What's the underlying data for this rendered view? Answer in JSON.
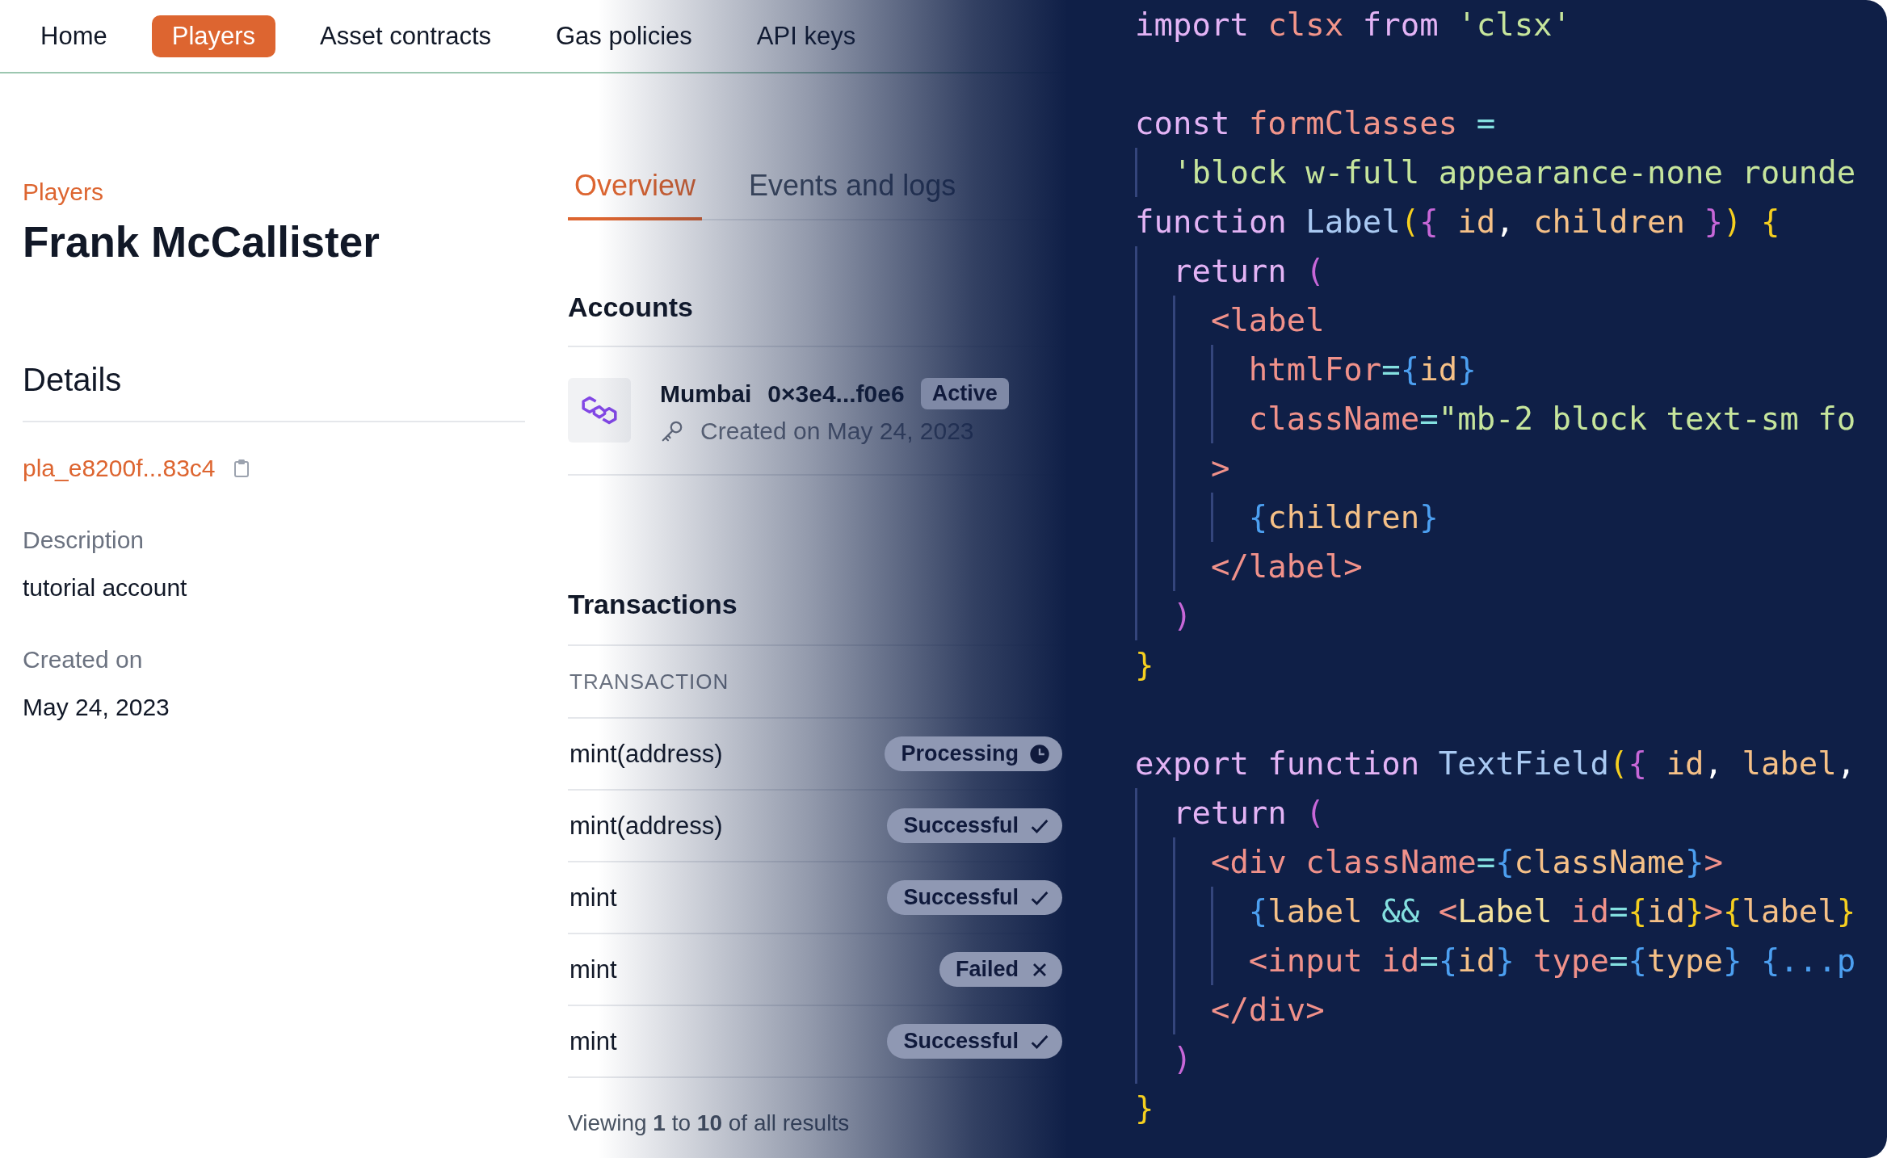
{
  "nav": {
    "items": [
      {
        "label": "Home",
        "selected": false
      },
      {
        "label": "Players",
        "selected": true
      },
      {
        "label": "Asset contracts",
        "selected": false
      },
      {
        "label": "Gas policies",
        "selected": false
      },
      {
        "label": "API keys",
        "selected": false
      }
    ]
  },
  "player": {
    "breadcrumb": "Players",
    "name": "Frank McCallister",
    "details_heading": "Details",
    "id": "pla_e8200f...83c4",
    "fields": [
      {
        "label": "Description",
        "value": "tutorial account"
      },
      {
        "label": "Created on",
        "value": "May 24, 2023"
      }
    ]
  },
  "tabs": [
    {
      "label": "Overview",
      "selected": true
    },
    {
      "label": "Events and logs",
      "selected": false
    }
  ],
  "accounts": {
    "heading": "Accounts",
    "items": [
      {
        "network": "Mumbai",
        "address": "0×3e4...f0e6",
        "status": "Active",
        "created": "Created on May 24, 2023"
      }
    ]
  },
  "transactions": {
    "heading": "Transactions",
    "column": "TRANSACTION",
    "rows": [
      {
        "name": "mint(address)",
        "status": "Processing",
        "kind": "processing"
      },
      {
        "name": "mint(address)",
        "status": "Successful",
        "kind": "success"
      },
      {
        "name": "mint",
        "status": "Successful",
        "kind": "success"
      },
      {
        "name": "mint",
        "status": "Failed",
        "kind": "failed"
      },
      {
        "name": "mint",
        "status": "Successful",
        "kind": "success"
      }
    ],
    "footer": "Viewing **1** to **10** of all results"
  },
  "code": {
    "lines": [
      {
        "kind": "code",
        "tokens": [
          {
            "t": "import ",
            "kind": "kw"
          },
          {
            "t": "clsx ",
            "kind": "var"
          },
          {
            "t": "from ",
            "kind": "kw"
          },
          {
            "t": "'clsx'",
            "kind": "str"
          }
        ]
      },
      {
        "kind": "blank"
      },
      {
        "kind": "code",
        "tokens": [
          {
            "t": "const ",
            "kind": "kw"
          },
          {
            "t": "formClasses ",
            "kind": "var"
          },
          {
            "t": "=",
            "kind": "op"
          }
        ]
      },
      {
        "kind": "code",
        "tokens": [
          {
            "t": "  'block w-full appearance-none rounde",
            "kind": "str"
          }
        ]
      },
      {
        "kind": "code",
        "tokens": [
          {
            "t": "function ",
            "kind": "kw"
          },
          {
            "t": "Label",
            "kind": "fn"
          },
          {
            "t": "(",
            "kind": "b1"
          },
          {
            "t": "{",
            "kind": "b2"
          },
          {
            "t": " id",
            "kind": "param"
          },
          {
            "t": ", ",
            "kind": "plain"
          },
          {
            "t": "children",
            "kind": "param"
          },
          {
            "t": " }",
            "kind": "b2"
          },
          {
            "t": ")",
            "kind": "b1"
          },
          {
            "t": " {",
            "kind": "b1"
          }
        ]
      },
      {
        "kind": "code",
        "tokens": [
          {
            "t": "  return ",
            "kind": "kw"
          },
          {
            "t": "(",
            "kind": "b2"
          }
        ]
      },
      {
        "kind": "code",
        "tokens": [
          {
            "t": "    <label",
            "kind": "tag"
          }
        ]
      },
      {
        "kind": "code",
        "tokens": [
          {
            "t": "      htmlFor",
            "kind": "tag"
          },
          {
            "t": "=",
            "kind": "op"
          },
          {
            "t": "{",
            "kind": "jsx"
          },
          {
            "t": "id",
            "kind": "param"
          },
          {
            "t": "}",
            "kind": "jsx"
          }
        ]
      },
      {
        "kind": "code",
        "tokens": [
          {
            "t": "      className",
            "kind": "tag"
          },
          {
            "t": "=",
            "kind": "op"
          },
          {
            "t": "\"mb-2 block text-sm fo",
            "kind": "str"
          }
        ]
      },
      {
        "kind": "code",
        "tokens": [
          {
            "t": "    >",
            "kind": "tag"
          }
        ]
      },
      {
        "kind": "code",
        "tokens": [
          {
            "t": "      {",
            "kind": "jsx"
          },
          {
            "t": "children",
            "kind": "param"
          },
          {
            "t": "}",
            "kind": "jsx"
          }
        ]
      },
      {
        "kind": "code",
        "tokens": [
          {
            "t": "    </label>",
            "kind": "tag"
          }
        ]
      },
      {
        "kind": "code",
        "tokens": [
          {
            "t": "  )",
            "kind": "b2"
          }
        ]
      },
      {
        "kind": "code",
        "tokens": [
          {
            "t": "}",
            "kind": "b1"
          }
        ]
      },
      {
        "kind": "blank"
      },
      {
        "kind": "code",
        "tokens": [
          {
            "t": "export function ",
            "kind": "kw"
          },
          {
            "t": "TextField",
            "kind": "fn"
          },
          {
            "t": "(",
            "kind": "b1"
          },
          {
            "t": "{",
            "kind": "b2"
          },
          {
            "t": " id",
            "kind": "param"
          },
          {
            "t": ", ",
            "kind": "plain"
          },
          {
            "t": "label",
            "kind": "param"
          },
          {
            "t": ",",
            "kind": "plain"
          }
        ]
      },
      {
        "kind": "code",
        "tokens": [
          {
            "t": "  return ",
            "kind": "kw"
          },
          {
            "t": "(",
            "kind": "b2"
          }
        ]
      },
      {
        "kind": "code",
        "tokens": [
          {
            "t": "    <div ",
            "kind": "tag"
          },
          {
            "t": "className",
            "kind": "tag"
          },
          {
            "t": "=",
            "kind": "op"
          },
          {
            "t": "{",
            "kind": "jsx"
          },
          {
            "t": "className",
            "kind": "param"
          },
          {
            "t": "}",
            "kind": "jsx"
          },
          {
            "t": ">",
            "kind": "tag"
          }
        ]
      },
      {
        "kind": "code",
        "tokens": [
          {
            "t": "      {",
            "kind": "jsx"
          },
          {
            "t": "label ",
            "kind": "param"
          },
          {
            "t": "&& ",
            "kind": "op"
          },
          {
            "t": "<",
            "kind": "tag"
          },
          {
            "t": "Label ",
            "kind": "comp"
          },
          {
            "t": "id",
            "kind": "tag"
          },
          {
            "t": "=",
            "kind": "op"
          },
          {
            "t": "{",
            "kind": "b1"
          },
          {
            "t": "id",
            "kind": "param"
          },
          {
            "t": "}",
            "kind": "b1"
          },
          {
            "t": ">",
            "kind": "tag"
          },
          {
            "t": "{",
            "kind": "b1"
          },
          {
            "t": "label",
            "kind": "param"
          },
          {
            "t": "}",
            "kind": "b1"
          }
        ]
      },
      {
        "kind": "code",
        "tokens": [
          {
            "t": "      <input ",
            "kind": "tag"
          },
          {
            "t": "id",
            "kind": "tag"
          },
          {
            "t": "=",
            "kind": "op"
          },
          {
            "t": "{",
            "kind": "jsx"
          },
          {
            "t": "id",
            "kind": "param"
          },
          {
            "t": "} ",
            "kind": "jsx"
          },
          {
            "t": "type",
            "kind": "tag"
          },
          {
            "t": "=",
            "kind": "op"
          },
          {
            "t": "{",
            "kind": "jsx"
          },
          {
            "t": "type",
            "kind": "param"
          },
          {
            "t": "} ",
            "kind": "jsx"
          },
          {
            "t": "{...p",
            "kind": "jsx"
          }
        ]
      },
      {
        "kind": "code",
        "tokens": [
          {
            "t": "    </div>",
            "kind": "tag"
          }
        ]
      },
      {
        "kind": "code",
        "tokens": [
          {
            "t": "  )",
            "kind": "b2"
          }
        ]
      },
      {
        "kind": "code",
        "tokens": [
          {
            "t": "}",
            "kind": "b1"
          }
        ]
      }
    ]
  }
}
